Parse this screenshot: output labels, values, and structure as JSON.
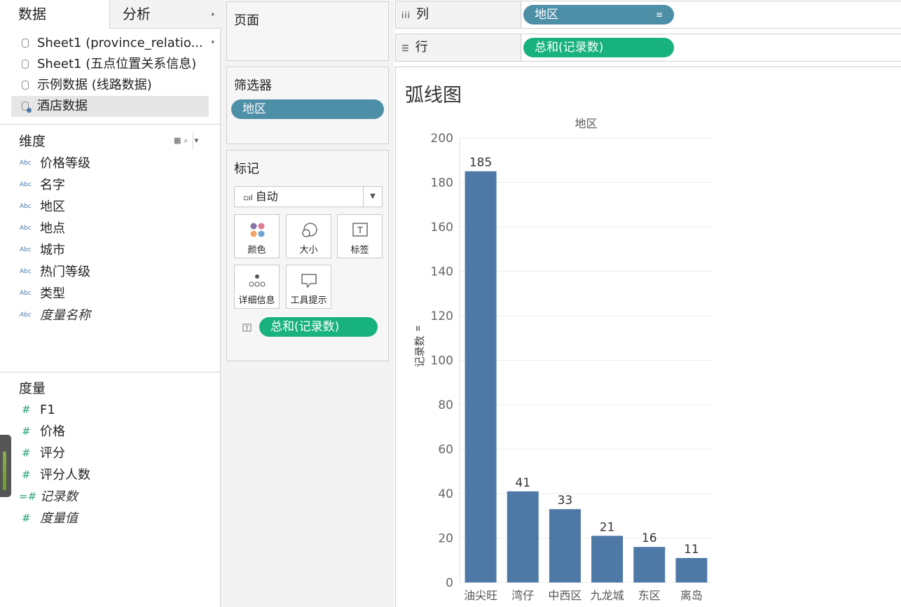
{
  "left_panel": {
    "tab_data": "数据",
    "tab_analysis": "分析",
    "datasources": [
      {
        "label": "Sheet1 (province_relatio..."
      },
      {
        "label": "Sheet1 (五点位置关系信息)"
      },
      {
        "label": "示例数据 (线路数据)"
      },
      {
        "label": "酒店数据"
      }
    ],
    "dimensions_title": "维度",
    "dimensions": [
      {
        "label": "价格等级",
        "icon": "Abc"
      },
      {
        "label": "名字",
        "icon": "Abc"
      },
      {
        "label": "地区",
        "icon": "Abc"
      },
      {
        "label": "地点",
        "icon": "Abc"
      },
      {
        "label": "城市",
        "icon": "Abc"
      },
      {
        "label": "热门等级",
        "icon": "Abc"
      },
      {
        "label": "类型",
        "icon": "Abc"
      },
      {
        "label": "度量名称",
        "icon": "Abc"
      }
    ],
    "measures_title": "度量",
    "measures": [
      {
        "label": "F1",
        "icon": "#"
      },
      {
        "label": "价格",
        "icon": "#"
      },
      {
        "label": "评分",
        "icon": "#"
      },
      {
        "label": "评分人数",
        "icon": "#"
      },
      {
        "label": "记录数",
        "icon": "=#"
      },
      {
        "label": "度量值",
        "icon": "#"
      }
    ]
  },
  "middle_panel": {
    "pages_title": "页面",
    "filters_title": "筛选器",
    "filter_pill": "地区",
    "marks_title": "标记",
    "mark_type": "自动",
    "mark_buttons": {
      "color": "颜色",
      "size": "大小",
      "label": "标签",
      "detail": "详细信息",
      "tooltip": "工具提示"
    },
    "label_pill": "总和(记录数)"
  },
  "shelves": {
    "columns_label": "列",
    "columns_pill": "地区",
    "rows_label": "行",
    "rows_pill": "总和(记录数)"
  },
  "sheet": {
    "title": "弧线图"
  },
  "colors": {
    "bar": "#4e79a7",
    "pill_blue": "#4e8fa8",
    "pill_green": "#18b27e"
  },
  "chart_data": {
    "type": "bar",
    "header": "地区",
    "categories": [
      "油尖旺",
      "湾仔",
      "中西区",
      "九龙城",
      "东区",
      "离岛"
    ],
    "values": [
      185,
      41,
      33,
      21,
      16,
      11
    ],
    "ylabel": "记录数",
    "ylim": [
      0,
      200
    ],
    "yticks": [
      0,
      20,
      40,
      60,
      80,
      100,
      120,
      140,
      160,
      180,
      200
    ],
    "grid": true,
    "data_labels": true
  }
}
